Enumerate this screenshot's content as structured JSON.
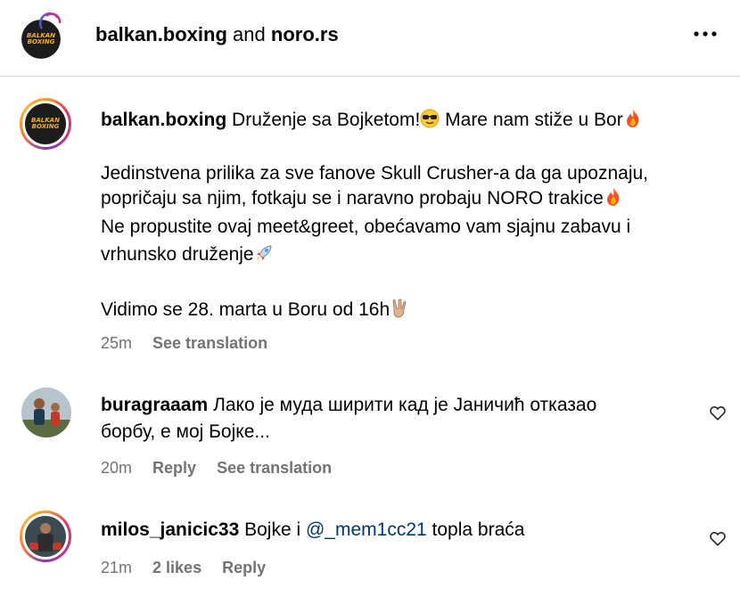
{
  "header": {
    "user1": "balkan.boxing",
    "joiner": "and",
    "user2": "noro.rs",
    "more_icon": "more-horizontal-icon",
    "logo_text_top": "BALKAN",
    "logo_text_bottom": "BOXING"
  },
  "post": {
    "username": "balkan.boxing",
    "line1": "Druženje sa Bojketom!",
    "line1b": "Mare nam stiže u Bor",
    "line2": "Jedinstvena prilika za sve fanove Skull Crusher-a da ga upoznaju,",
    "line3": "popričaju sa njim, fotkaju se i naravno probaju NORO trakice",
    "line4": "Ne propustite ovaj meet&greet, obećavamo vam sjajnu zabavu i",
    "line5": "vrhunsko druženje",
    "line6": "Vidimo se 28. marta u Boru od 16h",
    "time": "25m",
    "see_translation": "See translation",
    "icons": [
      "sunglasses-emoji",
      "fire-emoji",
      "rocket-emoji",
      "victory-hand-emoji"
    ]
  },
  "comments": [
    {
      "username": "buragraaam",
      "line1": "Лако је муда ширити кад је Јаничић отказао",
      "line2": "борбу, е мој Бојке...",
      "time": "20m",
      "reply": "Reply",
      "see_translation": "See translation"
    },
    {
      "username": "milos_janicic33",
      "text_before": "Bojke i",
      "mention": "@_mem1cc21",
      "text_after": "topla braća",
      "time": "21m",
      "likes": "2 likes",
      "reply": "Reply"
    }
  ],
  "colors": {
    "text": "#000000",
    "meta": "#737373",
    "mention": "#00376b",
    "divider": "#dbdbdb",
    "logo_accent": "#f3b21b"
  }
}
